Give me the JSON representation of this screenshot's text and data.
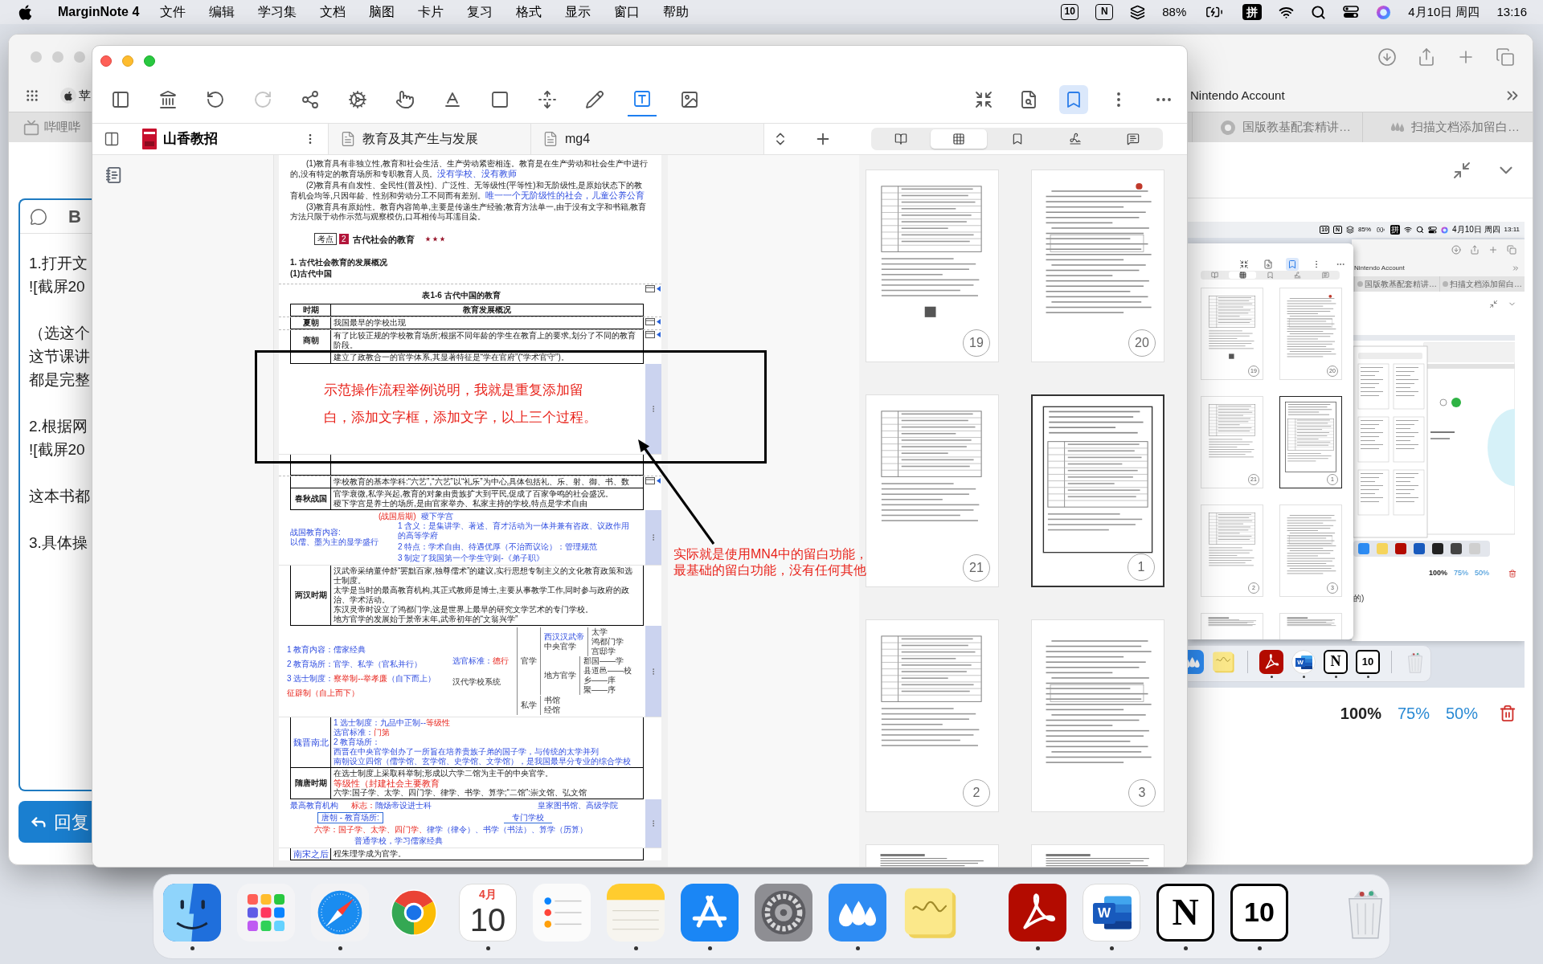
{
  "menu_bar": {
    "app_name": "MarginNote 4",
    "menus": [
      "文件",
      "编辑",
      "学习集",
      "文档",
      "脑图",
      "卡片",
      "复习",
      "格式",
      "显示",
      "窗口",
      "帮助"
    ],
    "status": {
      "badges": [
        "10",
        "N"
      ],
      "battery": "88%",
      "charging": true,
      "input_method": "拼",
      "date": "4月10日 周四",
      "time": "13:16"
    }
  },
  "browser": {
    "bookmarks": [
      {
        "label": "苹"
      },
      {
        "label": "Nintendo Account"
      }
    ],
    "tabs": [
      {
        "label": "哔哩哔",
        "selected": false
      },
      {
        "label": "国版教基配套精讲…",
        "selected": false
      },
      {
        "label": "扫描文档添加留白…",
        "selected": false
      }
    ],
    "editor": {
      "format_button": "B",
      "paragraphs": [
        [
          "1.打开文",
          "![截屏20"
        ],
        [
          "（选这个",
          "这节课讲",
          "都是完整"
        ],
        [
          "2.根据网",
          "![截屏20"
        ],
        [
          "这本书都"
        ],
        [
          "3.具体操"
        ]
      ]
    },
    "reply_button": "回复",
    "embedded_screenshot": {
      "status": {
        "badges": [
          "10",
          "N"
        ],
        "battery": "85%",
        "charging": true,
        "input_method": "拼",
        "date": "4月10日 周四",
        "time": "13:11"
      },
      "right_tools": [
        {
          "kind": "collapse",
          "selected": false
        },
        {
          "kind": "search",
          "selected": false
        },
        {
          "kind": "bookmark",
          "selected": true
        },
        {
          "kind": "kebab",
          "selected": false
        },
        {
          "kind": "more",
          "selected": false
        }
      ],
      "view_modes": [
        {
          "kind": "pages",
          "selected": false
        },
        {
          "kind": "grid",
          "selected": true
        },
        {
          "kind": "bookmarks",
          "selected": false
        },
        {
          "kind": "signature",
          "selected": false
        },
        {
          "kind": "notes",
          "selected": false
        }
      ],
      "thumbnails": [
        {
          "page": "19",
          "selected": false
        },
        {
          "page": "20",
          "selected": false
        },
        {
          "page": "21",
          "selected": false
        },
        {
          "page": "1",
          "selected": true
        },
        {
          "page": "2",
          "selected": false
        },
        {
          "page": "3",
          "selected": false
        },
        {
          "selected": false
        },
        {
          "selected": false
        }
      ],
      "bookmarks": [
        {
          "label": "Nintendo Account"
        }
      ],
      "tabs": [
        {
          "label": "国版教基配套精讲…",
          "selected": false
        },
        {
          "label": "扫描文档添加留白…",
          "selected": false
        }
      ],
      "zoom_options": [
        {
          "label": "100%",
          "selected": true
        },
        {
          "label": "75%",
          "selected": false
        },
        {
          "label": "50%",
          "selected": false
        }
      ],
      "text_fragment": "的)",
      "dock": {
        "groups": [
          [
            {
              "kind": "marginnote",
              "running": false
            },
            {
              "kind": "stickies",
              "running": false
            }
          ],
          [
            {
              "kind": "acrobat",
              "running": true
            },
            {
              "kind": "word",
              "glyph": "W",
              "running": true
            },
            {
              "kind": "notion",
              "glyph": "N",
              "running": true
            },
            {
              "kind": "ten",
              "glyph": "10",
              "running": true
            }
          ],
          [
            {
              "kind": "trash",
              "running": false
            }
          ]
        ]
      }
    },
    "zoom_options": [
      {
        "label": "100%",
        "selected": true
      },
      {
        "label": "75%",
        "selected": false
      },
      {
        "label": "50%",
        "selected": false
      }
    ]
  },
  "marginnote": {
    "toolbar": [
      {
        "kind": "sidebar",
        "selected": false,
        "disabled": false
      },
      {
        "kind": "library",
        "selected": false,
        "disabled": false
      },
      {
        "kind": "undo",
        "selected": false,
        "disabled": false
      },
      {
        "kind": "redo",
        "selected": false,
        "disabled": true
      },
      {
        "kind": "mindmap",
        "selected": false,
        "disabled": false
      },
      {
        "kind": "settings",
        "selected": false,
        "disabled": false
      },
      {
        "kind": "hand",
        "selected": false,
        "disabled": false
      },
      {
        "kind": "underline",
        "selected": false,
        "disabled": false
      },
      {
        "kind": "select",
        "selected": false,
        "disabled": false
      },
      {
        "kind": "resize",
        "selected": false,
        "disabled": false
      },
      {
        "kind": "pen",
        "selected": false,
        "disabled": false
      },
      {
        "kind": "textbox",
        "selected": true,
        "disabled": false
      },
      {
        "kind": "image",
        "selected": false,
        "disabled": false
      }
    ],
    "right_toolbar": [
      {
        "kind": "collapse",
        "selected": false
      },
      {
        "kind": "search",
        "selected": false
      },
      {
        "kind": "bookmark",
        "selected": true
      },
      {
        "kind": "kebab",
        "selected": false
      },
      {
        "kind": "more",
        "selected": false
      }
    ],
    "doc_tabs": [
      {
        "title": "山香教招",
        "kind": "book",
        "selected": true
      },
      {
        "title": "教育及其产生与发展",
        "kind": "doc",
        "selected": false
      },
      {
        "title": "mg4",
        "kind": "doc",
        "selected": false
      }
    ],
    "view_modes": [
      {
        "kind": "pages",
        "selected": false
      },
      {
        "kind": "grid",
        "selected": true
      },
      {
        "kind": "bookmarks",
        "selected": false
      },
      {
        "kind": "signature",
        "selected": false
      },
      {
        "kind": "notes",
        "selected": false
      }
    ],
    "document": {
      "paragraphs": [
        {
          "text": "(1)教育具有非独立性,教育和社会生活、生产劳动紧密相连。教育是在生产劳动和社会生产中进行的,没有特定的教育场所和专职教育人员。",
          "note": "没有学校、没有教师"
        },
        {
          "text": "(2)教育具有自发性、全民性(普及性)、广泛性、无等级性(平等性)和无阶级性,是原始状态下的教育机会均等,只因年龄、性别和劳动分工不同而有差别。",
          "note": "唯一一个无阶级性的社会，儿童公养公育"
        },
        {
          "text": "(3)教育具有原始性。教育内容简单,主要是传递生产经验;教育方法单一,由于没有文字和书籍,教育方法只限于动作示范与观察模仿,口耳相传与耳濡目染。"
        }
      ],
      "key_point": {
        "tag": "考点",
        "number": "2",
        "title": "古代社会的教育",
        "stars": 3
      },
      "headings": [
        "1. 古代社会教育的发展概况",
        "(1)古代中国"
      ],
      "table": {
        "caption": "表1-6 古代中国的教育",
        "marker": true,
        "columns": [
          "时期",
          "教育发展概况"
        ],
        "rows": [
          {
            "kind": "row",
            "period": "夏朝",
            "label_handwritten": false,
            "text_handwritten": false,
            "marker": true,
            "lines": [
              "我国最早的学校出现"
            ]
          },
          {
            "kind": "row",
            "period": "商朝",
            "label_handwritten": false,
            "text_handwritten": false,
            "marker": true,
            "lines": [
              "有了比较正规的学校教育场所;根据不同年龄的学生在教育上的要求,划分了不同的教育阶段。"
            ]
          },
          {
            "kind": "row",
            "text_handwritten": false,
            "marker": false,
            "lines": [
              "建立了政教合一的官学体系,其显著特征是“学在官府”(“学术官守”)。"
            ]
          },
          {
            "kind": "textbox",
            "lines": [
              "示范操作流程举例说明，我就是重复添加留",
              "白，添加文字框，添加文字，以上三个过程。"
            ]
          },
          {
            "kind": "row",
            "text_handwritten": false,
            "marker": true,
            "lines": [
              "学校教育的基本学科:“六艺”,“六艺”以“礼乐”为中心,具体包括礼、乐、射、御、书、数"
            ]
          },
          {
            "kind": "row",
            "period": "春秋战国",
            "label_handwritten": false,
            "text_handwritten": false,
            "marker": false,
            "lines": [
              "官学衰微,私学兴起,教育的对象由贵族扩大到平民,促成了百家争鸣的社会盛况。",
              "稷下学宫是养士的场所,是由官家举办、私家主持的学校,特点是学术自由"
            ]
          },
          {
            "kind": "notes",
            "tag": "(战国后期)",
            "title": "稷下学宫",
            "left": [
              "战国教育内容:",
              "以儒、墨为主的显学盛行"
            ],
            "right": [
              "1 含义：是集讲学、著述、育才活动为一体并兼有咨政、议政作用的高等学府",
              "2 特点：学术自由、待遇优厚（不治而议论）：管理规范",
              "3 制定了我国第一个学生守则-《弟子职》"
            ]
          },
          {
            "kind": "row",
            "period": "两汉时期",
            "label_handwritten": false,
            "text_handwritten": false,
            "marker": false,
            "lines": [
              "汉武帝采纳董仲舒“罢黜百家,独尊儒术”的建议,实行思想专制主义的文化教育政策和选士制度。",
              "太学是当时的最高教育机构,其正式教师是博士,主要从事教学工作,同时参与政府的政治、学术活动。",
              "东汉灵帝时设立了鸿都门学,这是世界上最早的研究文学艺术的专门学校。",
              "地方官学的发展始于景帝末年,武帝初年的“文翁兴学”"
            ]
          },
          {
            "kind": "mindmap",
            "points": [
              [
                {
                  "text": "1 教育内容：儒家经典"
                }
              ],
              [
                {
                  "text": "2 教育场所：官学、私学（官私并行）"
                }
              ],
              [
                {
                  "text": "3 选士制度："
                },
                {
                  "text": "察举制--举孝廉",
                  "red": true
                },
                {
                  "text": "（自下而上）"
                }
              ],
              [
                {
                  "text": "征辟制（自上而下）",
                  "red": true
                }
              ]
            ],
            "criterion": [
              {
                "text": "选官标准："
              },
              {
                "text": "德行",
                "red": true
              }
            ],
            "tree": {
              "label": "汉代学校系统",
              "children": [
                {
                  "label": "官学",
                  "children": [
                    {
                      "label": "中央官学",
                      "note": "西汉汉武帝",
                      "children": [
                        {
                          "label": "太学"
                        },
                        {
                          "label": "鸿都门学"
                        },
                        {
                          "label": "宫邸学"
                        }
                      ]
                    },
                    {
                      "label": "地方官学",
                      "children": [
                        {
                          "label": "郡国——学"
                        },
                        {
                          "label": "县道邑——校"
                        },
                        {
                          "label": "乡——庠"
                        },
                        {
                          "label": "聚——序"
                        }
                      ]
                    }
                  ]
                },
                {
                  "label": "私学",
                  "children": [
                    {
                      "label": "书馆"
                    },
                    {
                      "label": "经馆"
                    }
                  ]
                }
              ]
            }
          },
          {
            "kind": "row",
            "period": "魏晋南北",
            "label_handwritten": true,
            "text_handwritten": true,
            "marker": false,
            "lines": [
              [
                {
                  "text": "1 选士制度：九品中正制--"
                },
                {
                  "text": "等级性",
                  "red": true
                }
              ],
              [
                {
                  "text": "选官标准："
                },
                {
                  "text": "门第",
                  "red": true
                }
              ],
              [
                {
                  "text": "2 教育场所："
                }
              ],
              [
                {
                  "text": "西晋在中央官学创办了一所旨在培养贵族子弟的国子学，与传统的太学并列"
                }
              ],
              [
                {
                  "text": "南朝设立四馆（儒学馆、玄学馆、史学馆、文学馆），是我国最早分专业的综合学校"
                }
              ]
            ]
          },
          {
            "kind": "row",
            "period": "隋唐时期",
            "label_handwritten": false,
            "text_handwritten": false,
            "marker": false,
            "lines": [
              "在选士制度上采取科举制;形成以六学二馆为主干的中央官学。",
              "六学:国子学、太学、四门学、律学、书学、算学;“二馆”:崇文馆、弘文馆"
            ],
            "note": "等级性（封建社会主要教育"
          },
          {
            "kind": "annotations",
            "left_note": "最高教育机构",
            "sign_note": [
              {
                "text": "标志：",
                "red": true
              },
              {
                "text": "隋炀帝设进士科"
              }
            ],
            "right_note": "皇家图书馆、高级学院",
            "boxed_title": "唐朝 - 教育场所:",
            "bracket_label": "专门学校",
            "schools": [
              {
                "text": "六学：国子学、太学、四门学、",
                "red": true
              },
              {
                "text": "律学（律令）、书学（书法）、算学（历算）"
              }
            ],
            "footer": "普通学校，学习儒家经典"
          },
          {
            "kind": "row",
            "period": "南宋之后",
            "label_handwritten": true,
            "text_handwritten": false,
            "marker": false,
            "lines": [
              "程朱理学成为官学。"
            ]
          }
        ]
      }
    },
    "thumbnails": [
      {
        "page": "19",
        "selected": false
      },
      {
        "page": "20",
        "selected": false
      },
      {
        "page": "21",
        "selected": false
      },
      {
        "page": "1",
        "selected": true
      },
      {
        "page": "2",
        "selected": false
      },
      {
        "page": "3",
        "selected": false
      },
      {
        "selected": false
      },
      {
        "selected": false
      }
    ]
  },
  "annotation": {
    "callout": [
      "实际就是使用MN4中的留白功能，",
      "最基础的留白功能，没有任何其他"
    ]
  },
  "dock": {
    "groups": [
      [
        {
          "kind": "finder",
          "running": true
        },
        {
          "kind": "launchpad",
          "running": false
        },
        {
          "kind": "safari",
          "running": true
        },
        {
          "kind": "chrome",
          "running": false
        },
        {
          "kind": "calendar",
          "month": "4月",
          "day": "10",
          "running": true
        },
        {
          "kind": "reminders",
          "running": false
        },
        {
          "kind": "notes",
          "running": true
        },
        {
          "kind": "appstore",
          "running": true
        },
        {
          "kind": "settings",
          "running": false
        },
        {
          "kind": "marginnote",
          "running": true
        },
        {
          "kind": "stickies",
          "running": false
        }
      ],
      [
        {
          "kind": "acrobat",
          "running": true
        },
        {
          "kind": "word",
          "glyph": "W",
          "running": true
        },
        {
          "kind": "notion",
          "glyph": "N",
          "running": true
        },
        {
          "kind": "ten",
          "glyph": "10",
          "running": true
        }
      ],
      [
        {
          "kind": "trash",
          "running": false
        }
      ]
    ]
  }
}
